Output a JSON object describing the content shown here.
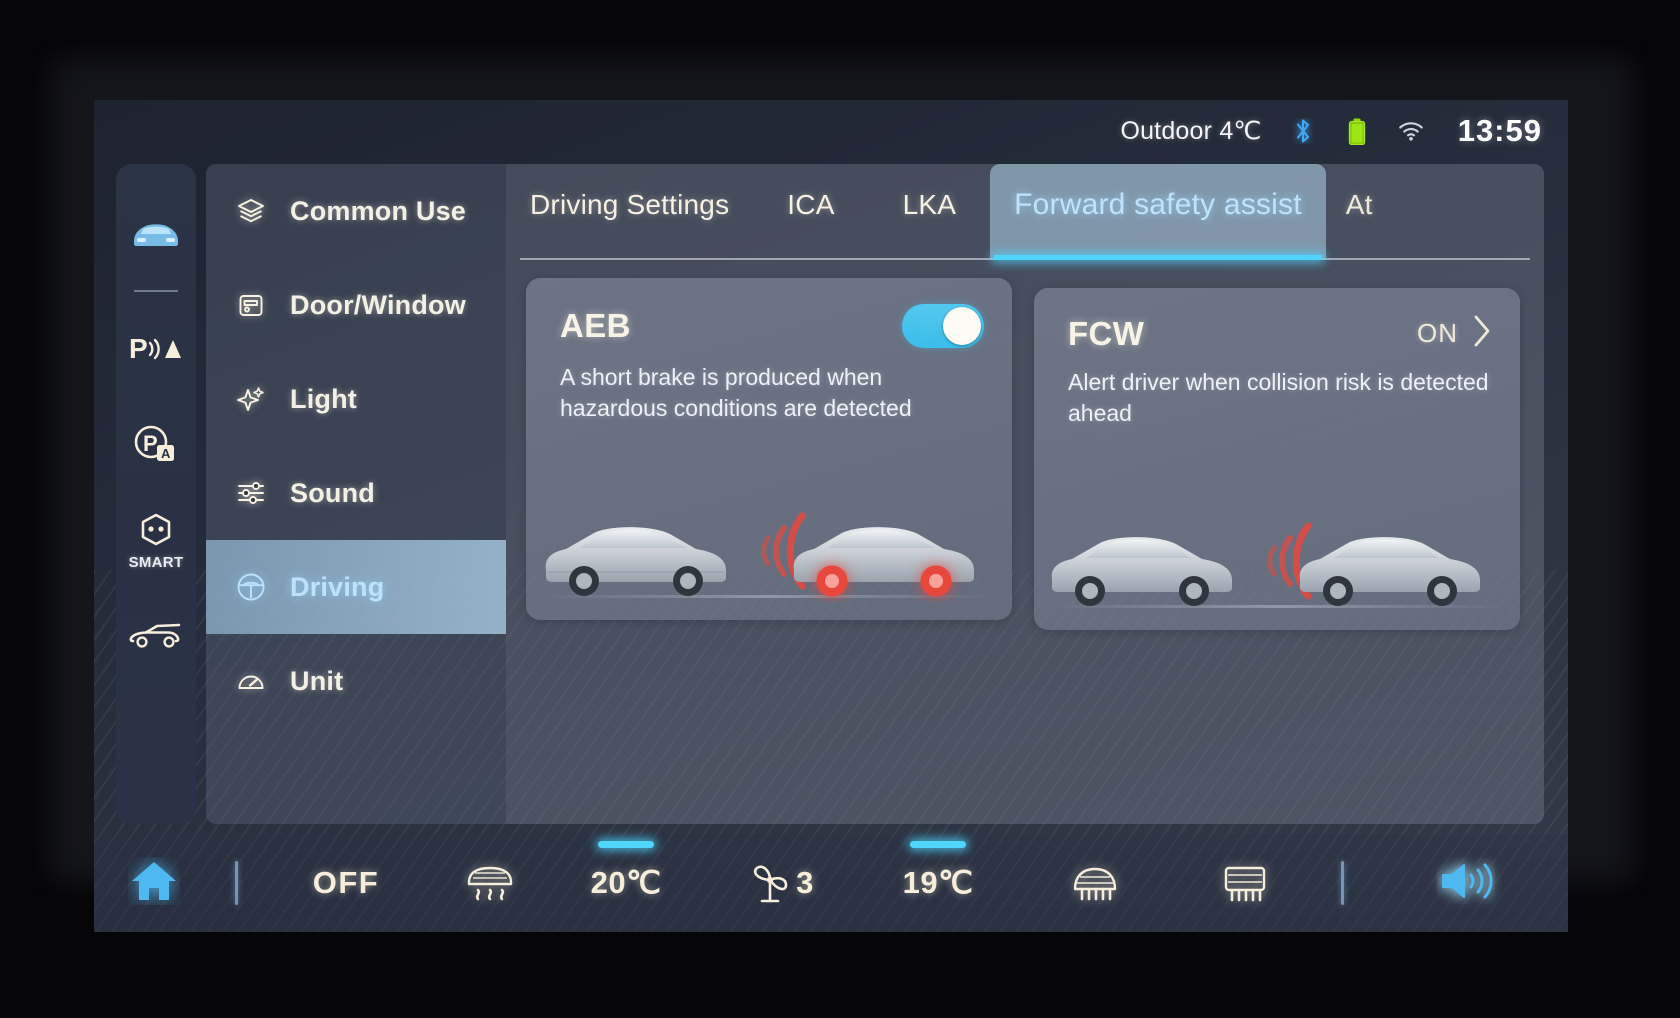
{
  "statusbar": {
    "outdoor_temp": "Outdoor 4℃",
    "bluetooth_icon": "bluetooth-icon",
    "battery_icon": "battery-icon",
    "wifi_icon": "wifi-icon",
    "time": "13:59"
  },
  "rail": {
    "items": [
      {
        "name": "vehicle-front-icon",
        "label": "",
        "active": true
      },
      {
        "name": "parking-sensor-icon",
        "label": ""
      },
      {
        "name": "auto-parking-icon",
        "label": ""
      },
      {
        "name": "smart-icon",
        "label": "SMART"
      },
      {
        "name": "tailgate-icon",
        "label": ""
      }
    ]
  },
  "menu": {
    "items": [
      {
        "label": "Common Use",
        "icon": "layers-icon",
        "active": false
      },
      {
        "label": "Door/Window",
        "icon": "door-icon",
        "active": false
      },
      {
        "label": "Light",
        "icon": "sparkle-icon",
        "active": false
      },
      {
        "label": "Sound",
        "icon": "sliders-icon",
        "active": false
      },
      {
        "label": "Driving",
        "icon": "steering-wheel-icon",
        "active": true
      },
      {
        "label": "Unit",
        "icon": "gauge-icon",
        "active": false
      }
    ]
  },
  "tabs": [
    {
      "label": "Driving Settings",
      "active": false
    },
    {
      "label": "ICA",
      "active": false
    },
    {
      "label": "LKA",
      "active": false
    },
    {
      "label": "Forward safety assist",
      "active": true
    },
    {
      "label": "At",
      "active": false,
      "clipped": true
    }
  ],
  "cards": [
    {
      "title": "AEB",
      "description": "A short brake is produced when hazardous conditions are detected",
      "control": "toggle",
      "toggle_on": true,
      "illustration": "two-cars-braking-radar"
    },
    {
      "title": "FCW",
      "description": "Alert driver when collision risk is detected ahead",
      "control": "value",
      "value": "ON",
      "chevron": "chevron-right-icon",
      "illustration": "two-cars-warning-radar"
    }
  ],
  "bottombar": {
    "home_icon": "home-icon",
    "ac_state": "OFF",
    "defrost_front_icon": "front-defrost-icon",
    "driver_temp": "20℃",
    "fan_icon": "fan-icon",
    "fan_speed": "3",
    "passenger_temp": "19℃",
    "rear_defrost_icon": "rear-defrost-icon",
    "windshield_defrost_icon": "windshield-defrost-icon",
    "volume_icon": "volume-icon"
  },
  "colors": {
    "accent_cyan": "#4ed6ff",
    "active_tab_bg": "#a5c3d8",
    "active_menu_text": "#bfe2fb",
    "warm_text": "#f6eedb",
    "battery_green": "#8ed600",
    "bluetooth_blue": "#3fa9f5",
    "radar_red": "#e8483c"
  }
}
